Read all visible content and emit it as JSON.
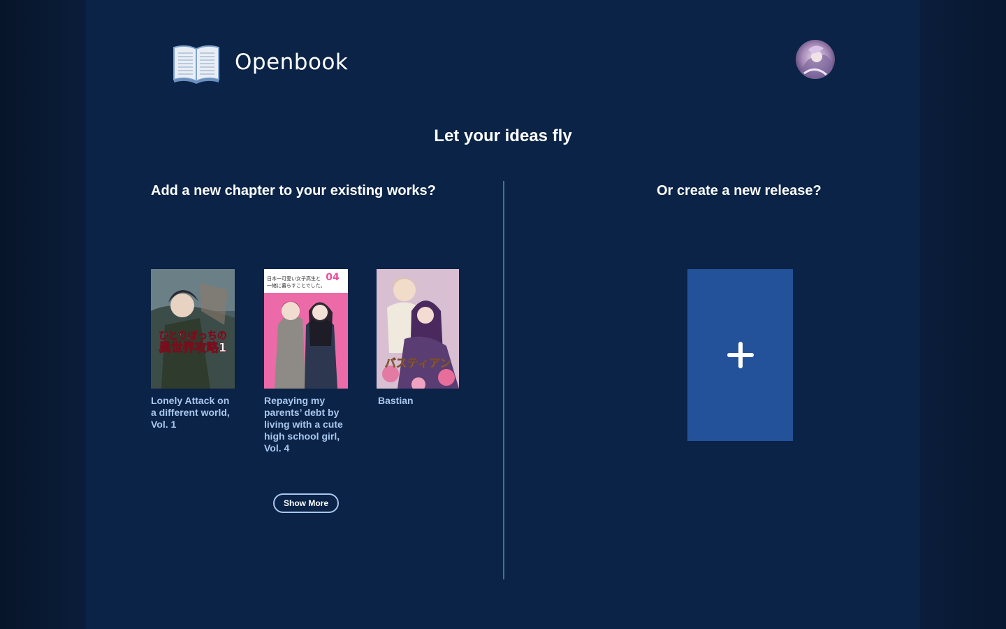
{
  "header": {
    "app_name": "Openbook"
  },
  "hero": {
    "tagline": "Let your ideas fly"
  },
  "existing_works": {
    "heading": "Add a new chapter to your existing works?",
    "books": [
      {
        "title": "Lonely Attack on a different world, Vol. 1",
        "cover_text": "ひとりぼっちの異世界攻略1"
      },
      {
        "title": "Repaying my parents’ debt by living with a cute high school girl, Vol. 4",
        "cover_text": "日本一可愛い女子高生と一緒に暮らすことでした。 04"
      },
      {
        "title": "Bastian",
        "cover_text": "バスティアン"
      }
    ],
    "show_more_label": "Show More"
  },
  "new_release": {
    "heading": "Or create a new release?",
    "icon": "plus-icon"
  },
  "colors": {
    "background": "#0a2346",
    "accent": "#23529a",
    "link": "#a8c6ee"
  }
}
